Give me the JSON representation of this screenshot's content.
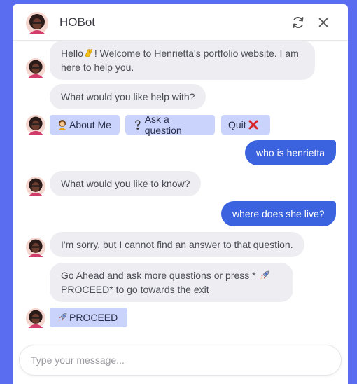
{
  "header": {
    "title": "HOBot"
  },
  "messages": {
    "m1_part1": "Hello",
    "m1_part2": "! Welcome to Henrietta's portfolio website. I am",
    "m1_line2": "here to help you.",
    "m2": "What would you like help with?",
    "chips": {
      "about": "About Me",
      "ask": "Ask a question",
      "quit": "Quit"
    },
    "user1": "who is henrietta",
    "m3": "What would you like to know?",
    "user2": "where does she live?",
    "m4": "I'm sorry, but I cannot find an answer to that question.",
    "m5_line1": "Go Ahead and ask more questions or press * ",
    "m5_line2": "PROCEED* to go towards the exit",
    "proceed": "PROCEED"
  },
  "composer": {
    "placeholder": "Type your message..."
  },
  "colors": {
    "background": "#5a6df0",
    "user_bubble": "#3b63e0",
    "bot_bubble": "#eeeef2",
    "chip": "#c9d3fb"
  },
  "icons": [
    "avatar",
    "refresh-icon",
    "close-icon",
    "waving-hand-icon",
    "woman-icon",
    "question-mark-icon",
    "cross-mark-icon",
    "rocket-icon"
  ]
}
